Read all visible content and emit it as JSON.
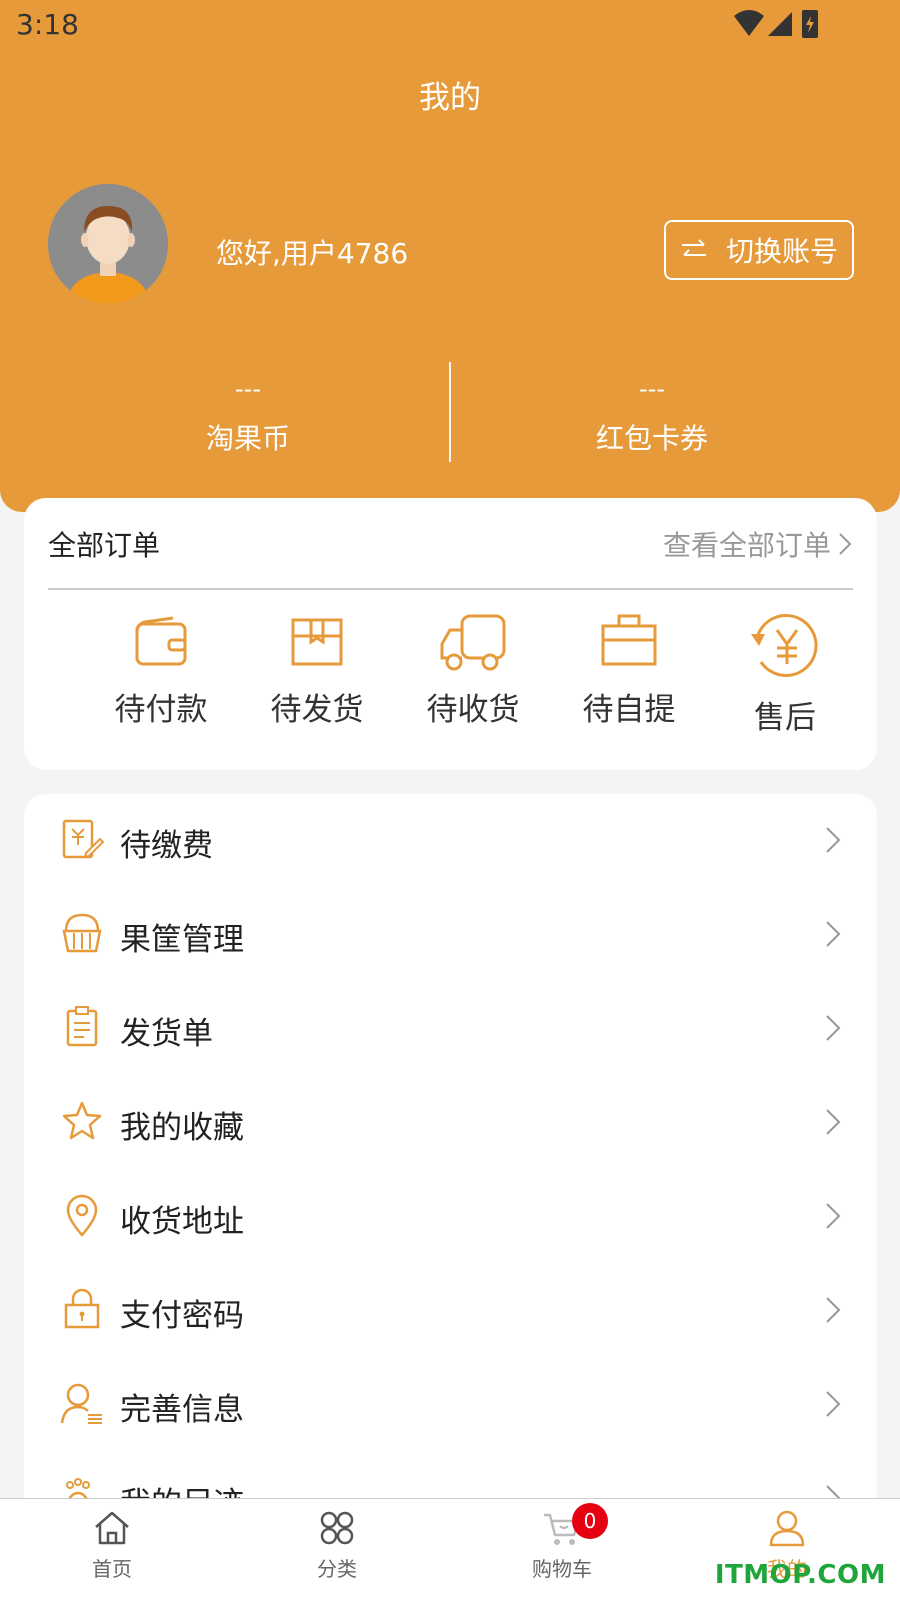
{
  "status_bar": {
    "time": "3:18"
  },
  "header": {
    "title": "我的",
    "greeting": "您好,用户4786",
    "switch_account": "切换账号",
    "stats": [
      {
        "value": "---",
        "label": "淘果币"
      },
      {
        "value": "---",
        "label": "红包卡券"
      }
    ]
  },
  "orders": {
    "title": "全部订单",
    "view_all": "查看全部订单",
    "items": [
      {
        "label": "待付款",
        "icon": "wallet-icon"
      },
      {
        "label": "待发货",
        "icon": "package-icon"
      },
      {
        "label": "待收货",
        "icon": "truck-icon"
      },
      {
        "label": "待自提",
        "icon": "briefcase-icon"
      },
      {
        "label": "售后",
        "icon": "yuan-refund-icon"
      }
    ]
  },
  "menu": [
    {
      "label": "待缴费",
      "icon": "bill-edit-icon"
    },
    {
      "label": "果筐管理",
      "icon": "basket-icon"
    },
    {
      "label": "发货单",
      "icon": "clipboard-icon"
    },
    {
      "label": "我的收藏",
      "icon": "star-icon"
    },
    {
      "label": "收货地址",
      "icon": "location-pin-icon"
    },
    {
      "label": "支付密码",
      "icon": "lock-icon"
    },
    {
      "label": "完善信息",
      "icon": "user-info-icon"
    },
    {
      "label": "我的足迹",
      "icon": "footprint-icon"
    }
  ],
  "bottom_nav": [
    {
      "label": "首页",
      "icon": "home-icon"
    },
    {
      "label": "分类",
      "icon": "category-icon"
    },
    {
      "label": "购物车",
      "icon": "cart-icon",
      "badge": "0"
    },
    {
      "label": "我的",
      "icon": "user-icon",
      "active": true
    }
  ],
  "watermark": "ITMOP.COM",
  "colors": {
    "accent": "#e69a3a",
    "badge": "#e60012",
    "watermark": "#1fa63a"
  }
}
